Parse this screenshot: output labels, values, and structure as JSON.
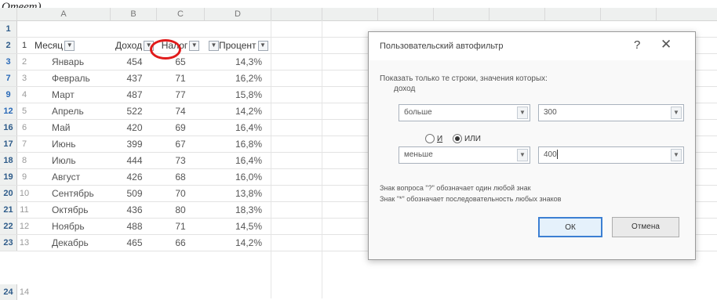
{
  "caption": "Ответ)",
  "sheet": {
    "columns": [
      "A",
      "B",
      "C",
      "D"
    ],
    "header": {
      "num": "1",
      "month": "Месяц",
      "income": "Доход",
      "tax": "Налог",
      "pct": "Процент"
    },
    "rows": [
      {
        "rownum": "3",
        "num": "2",
        "month": "Январь",
        "income": "454",
        "tax": "65",
        "pct": "14,3%"
      },
      {
        "rownum": "7",
        "num": "3",
        "month": "Февраль",
        "income": "437",
        "tax": "71",
        "pct": "16,2%"
      },
      {
        "rownum": "9",
        "num": "4",
        "month": "Март",
        "income": "487",
        "tax": "77",
        "pct": "15,8%"
      },
      {
        "rownum": "12",
        "num": "5",
        "month": "Апрель",
        "income": "522",
        "tax": "74",
        "pct": "14,2%"
      },
      {
        "rownum": "16",
        "num": "6",
        "month": "Май",
        "income": "420",
        "tax": "69",
        "pct": "16,4%"
      },
      {
        "rownum": "17",
        "num": "7",
        "month": "Июнь",
        "income": "399",
        "tax": "67",
        "pct": "16,8%"
      },
      {
        "rownum": "18",
        "num": "8",
        "month": "Июль",
        "income": "444",
        "tax": "73",
        "pct": "16,4%"
      },
      {
        "rownum": "19",
        "num": "9",
        "month": "Август",
        "income": "426",
        "tax": "68",
        "pct": "16,0%"
      },
      {
        "rownum": "20",
        "num": "10",
        "month": "Сентябрь",
        "income": "509",
        "tax": "70",
        "pct": "13,8%"
      },
      {
        "rownum": "21",
        "num": "11",
        "month": "Октябрь",
        "income": "436",
        "tax": "80",
        "pct": "18,3%"
      },
      {
        "rownum": "22",
        "num": "12",
        "month": "Ноябрь",
        "income": "488",
        "tax": "71",
        "pct": "14,5%"
      },
      {
        "rownum": "23",
        "num": "13",
        "month": "Декабрь",
        "income": "465",
        "tax": "66",
        "pct": "14,2%"
      }
    ],
    "header_rownum": "2",
    "first_rownum": "1",
    "last_rownum": "24",
    "last_row_text": "14"
  },
  "dialog": {
    "title": "Пользовательский автофильтр",
    "help": "?",
    "close": "✕",
    "description": "Показать только те строки, значения которых:",
    "field": "доход",
    "cond1": {
      "operator": "больше",
      "value": "300"
    },
    "and_label": "И",
    "or_label": "ИЛИ",
    "selected_logic": "or",
    "cond2": {
      "operator": "меньше",
      "value": "400"
    },
    "hint1": "Знак вопроса \"?\" обозначает один любой знак",
    "hint2": "Знак \"*\" обозначает последовательность любых знаков",
    "ok": "ОК",
    "cancel": "Отмена"
  },
  "colors": {
    "accent": "#3c7fd3",
    "highlight_circle": "#e11b1b",
    "excel_green": "#217346"
  }
}
